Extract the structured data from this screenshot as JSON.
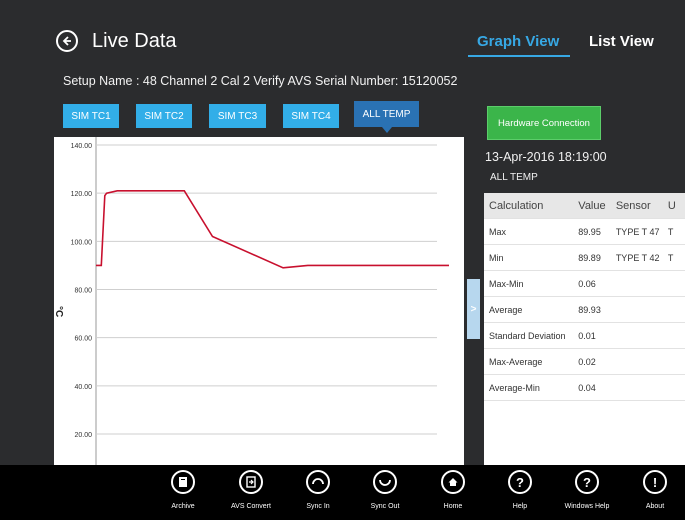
{
  "header": {
    "title": "Live Data",
    "tab_graph": "Graph View",
    "tab_list": "List View"
  },
  "setup_line": "Setup Name : 48 Channel 2 Cal 2 Verify   AVS Serial Number:  15120052",
  "sensor_tabs": [
    "SIM TC1",
    "SIM TC2",
    "SIM TC3",
    "SIM TC4",
    "ALL TEMP"
  ],
  "hardware_button": "Hardware Connection",
  "timestamp": "13-Apr-2016 18:19:00",
  "table_title": "ALL TEMP",
  "table": {
    "headers": [
      "Calculation",
      "Value",
      "Sensor",
      "U"
    ],
    "rows": [
      [
        "Max",
        "89.95",
        "TYPE T 47",
        "T"
      ],
      [
        "Min",
        "89.89",
        "TYPE T 42",
        "T"
      ],
      [
        "Max-Min",
        "0.06",
        "",
        ""
      ],
      [
        "Average",
        "89.93",
        "",
        ""
      ],
      [
        "Standard Deviation",
        "0.01",
        "",
        ""
      ],
      [
        "Max-Average",
        "0.02",
        "",
        ""
      ],
      [
        "Average-Min",
        "0.04",
        "",
        ""
      ]
    ]
  },
  "chart_data": {
    "type": "line",
    "ylabel": "°C",
    "ylim": [
      20,
      140
    ],
    "yticks": [
      "140.00",
      "120.00",
      "100.00",
      "80.00",
      "60.00",
      "40.00",
      "20.00"
    ],
    "grid": "horizontal",
    "color": "#c8102e",
    "series": [
      {
        "x": [
          0,
          1.5,
          2.5,
          3,
          6,
          20,
          25,
          33,
          53,
          60,
          100
        ],
        "y": [
          90,
          90,
          119,
          120,
          121,
          121,
          121,
          102,
          89,
          90,
          90
        ]
      }
    ]
  },
  "bottom_bar": [
    "Archive",
    "AVS Convert",
    "Sync In",
    "Sync Out",
    "Home",
    "Help",
    "Windows Help",
    "About"
  ]
}
